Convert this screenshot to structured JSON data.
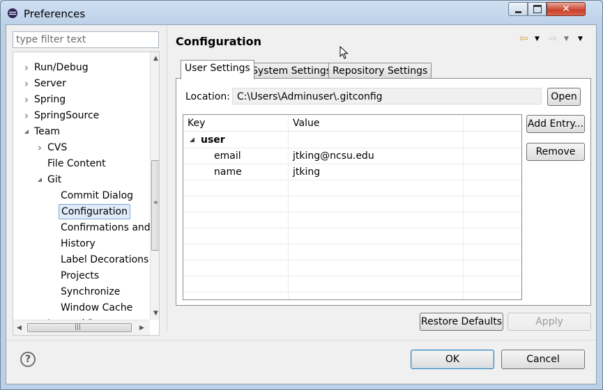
{
  "window": {
    "title": "Preferences"
  },
  "filter": {
    "placeholder": "type filter text"
  },
  "tree": {
    "items": [
      {
        "label": "Run/Debug",
        "expander": "closed"
      },
      {
        "label": "Server",
        "expander": "closed"
      },
      {
        "label": "Spring",
        "expander": "closed"
      },
      {
        "label": "SpringSource",
        "expander": "closed"
      },
      {
        "label": "Team",
        "expander": "open"
      },
      {
        "label": "CVS",
        "expander": "closed"
      },
      {
        "label": "File Content",
        "expander": "none"
      },
      {
        "label": "Git",
        "expander": "open"
      },
      {
        "label": "Commit Dialog",
        "expander": "none"
      },
      {
        "label": "Configuration",
        "expander": "none",
        "selected": true
      },
      {
        "label": "Confirmations and W",
        "expander": "none"
      },
      {
        "label": "History",
        "expander": "none"
      },
      {
        "label": "Label Decorations",
        "expander": "none"
      },
      {
        "label": "Projects",
        "expander": "none"
      },
      {
        "label": "Synchronize",
        "expander": "none"
      },
      {
        "label": "Window Cache",
        "expander": "none"
      },
      {
        "label": "Ignored Resources",
        "expander": "none"
      }
    ]
  },
  "page": {
    "title": "Configuration",
    "tabs": [
      {
        "label": "User Settings",
        "active": true
      },
      {
        "label": "System Settings"
      },
      {
        "label": "Repository Settings"
      }
    ],
    "location_label": "Location:",
    "location_value": "C:\\Users\\Adminuser\\.gitconfig",
    "open_button": "Open",
    "table": {
      "columns": [
        "Key",
        "Value"
      ],
      "rows": [
        {
          "key": "user",
          "value": "",
          "group": true
        },
        {
          "key": "email",
          "value": "jtking@ncsu.edu"
        },
        {
          "key": "name",
          "value": "jtking"
        }
      ]
    },
    "add_entry_button": "Add Entry...",
    "remove_button": "Remove",
    "restore_defaults_button": "Restore Defaults",
    "apply_button": "Apply"
  },
  "footer": {
    "ok_button": "OK",
    "cancel_button": "Cancel"
  },
  "colors": {
    "selection_bg": "#e1ecfb",
    "selection_border": "#7da2ce",
    "close_red": "#c8412b"
  },
  "icons": [
    "eclipse-icon",
    "minimize-icon",
    "maximize-icon",
    "close-icon",
    "back-icon",
    "forward-icon",
    "view-menu-icon",
    "help-icon"
  ]
}
